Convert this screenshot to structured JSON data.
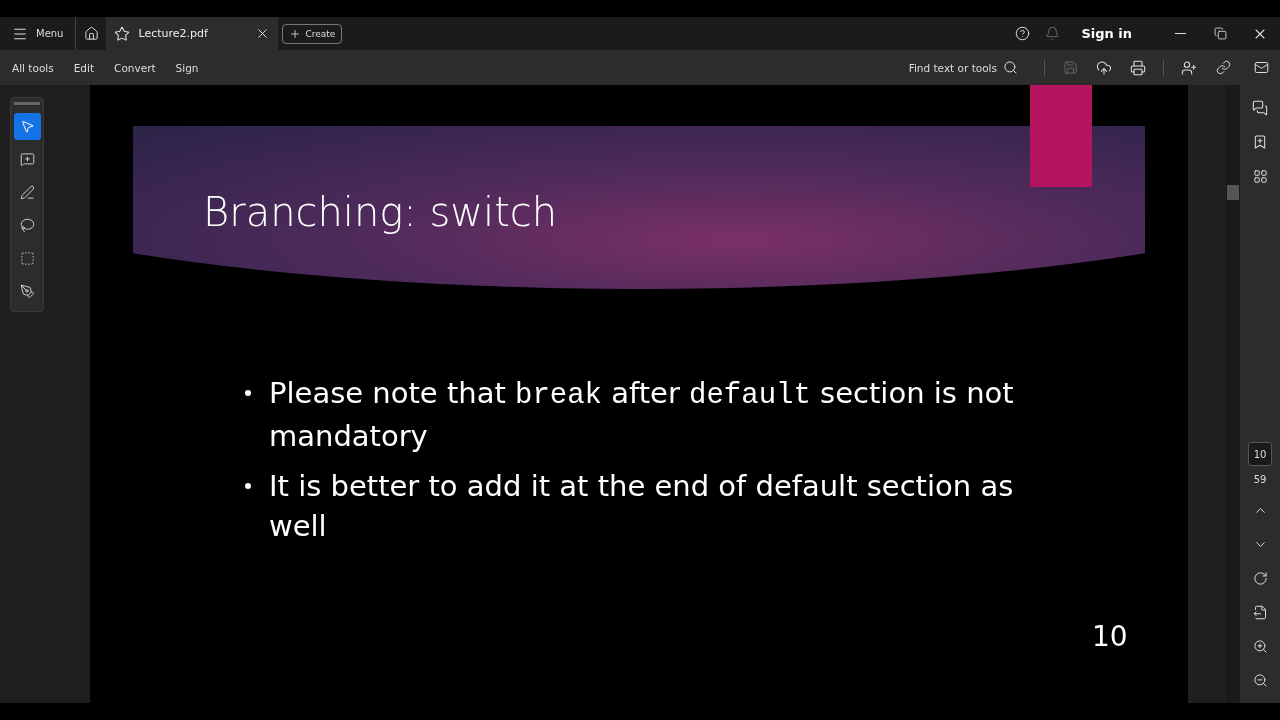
{
  "title_bar": {
    "menu": "Menu",
    "tab": {
      "label": "Lecture2.pdf",
      "selected": true
    },
    "create": "Create",
    "sign_in": "Sign in"
  },
  "toolbar": {
    "items": [
      "All tools",
      "Edit",
      "Convert",
      "Sign"
    ],
    "search": "Find text or tools"
  },
  "tools": [
    {
      "kind": "select",
      "selected": true
    },
    {
      "kind": "comment",
      "selected": false
    },
    {
      "kind": "draw",
      "selected": false
    },
    {
      "kind": "lasso",
      "selected": false
    },
    {
      "kind": "text",
      "selected": false
    },
    {
      "kind": "sign",
      "selected": false
    }
  ],
  "slide": {
    "title": "Branching: switch",
    "bullets": [
      [
        {
          "kind": "text",
          "text": "Please note that "
        },
        {
          "kind": "code",
          "text": "break"
        },
        {
          "kind": "text",
          "text": " after "
        },
        {
          "kind": "code",
          "text": "default"
        },
        {
          "kind": "text",
          "text": " section is not mandatory"
        }
      ],
      [
        {
          "kind": "text",
          "text": "It is better to add it at the end of default section as well"
        }
      ]
    ],
    "page_number": "10"
  },
  "page_nav": {
    "current": "10",
    "total": "59"
  }
}
